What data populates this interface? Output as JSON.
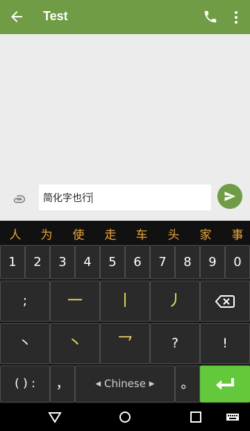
{
  "app_bar": {
    "title": "Test",
    "back_icon": "arrow-back-icon",
    "call_icon": "phone-icon",
    "menu_icon": "more-vert-icon",
    "color": "#6f9c44"
  },
  "composer": {
    "text": "简化字也行",
    "attach_icon": "paperclip-icon",
    "send_icon": "send-icon"
  },
  "keyboard": {
    "candidates": [
      "人",
      "为",
      "使",
      "走",
      "车",
      "头",
      "家",
      "事"
    ],
    "number_row": [
      "1",
      "2",
      "3",
      "4",
      "5",
      "6",
      "7",
      "8",
      "9",
      "0"
    ],
    "row1": [
      ";",
      "一",
      "丨",
      "丿",
      "backspace"
    ],
    "row2": [
      "丶",
      "丶",
      "乛",
      "?",
      "!"
    ],
    "row3": {
      "punct": "( ) :",
      "comma": "，",
      "space": "Chinese",
      "period": "。"
    },
    "accent_candidate": "#e9a43b",
    "accent_stroke": "#f3e05a",
    "accent_enter": "#64c83c"
  },
  "navbar": {
    "back": "back-triangle-icon",
    "home": "home-circle-icon",
    "recents": "recents-square-icon",
    "keyboard": "keyboard-icon"
  }
}
